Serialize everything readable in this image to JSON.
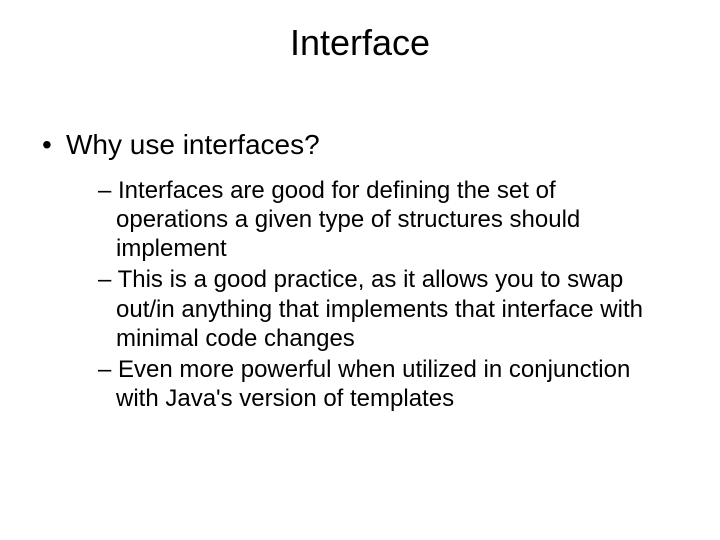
{
  "title": "Interface",
  "l1": {
    "bullet": "•",
    "text": "Why use interfaces?"
  },
  "l2": {
    "dash": "– ",
    "items": [
      "Interfaces are good for defining the set of operations a given type of structures should implement",
      "This is a good practice, as it allows you to swap out/in anything that implements that interface with minimal code changes",
      "Even more powerful when utilized in conjunction with Java's version of templates"
    ]
  }
}
